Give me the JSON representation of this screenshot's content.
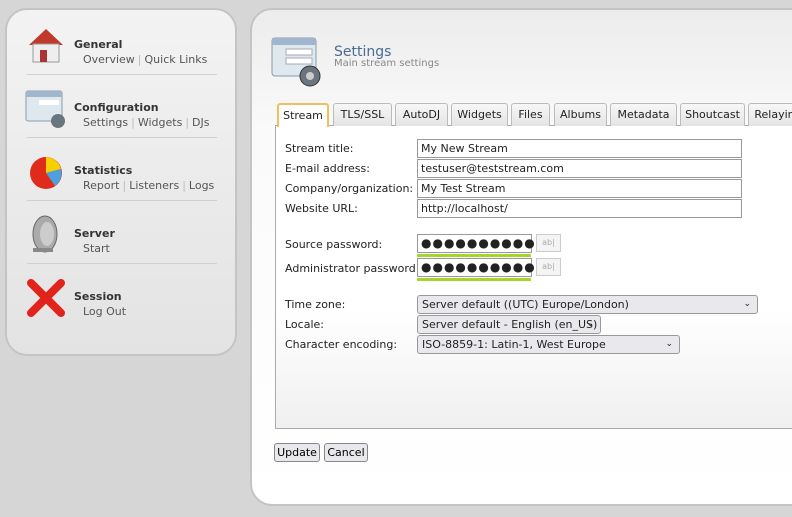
{
  "sidebar": {
    "sections": [
      {
        "title": "General",
        "icon": "house-icon",
        "links": [
          "Overview",
          "Quick Links"
        ]
      },
      {
        "title": "Configuration",
        "icon": "config-form-icon",
        "links": [
          "Settings",
          "Widgets",
          "DJs"
        ]
      },
      {
        "title": "Statistics",
        "icon": "pie-chart-icon",
        "links": [
          "Report",
          "Listeners",
          "Logs"
        ]
      },
      {
        "title": "Server",
        "icon": "satellite-dish-icon",
        "links": [
          "Start"
        ]
      },
      {
        "title": "Session",
        "icon": "red-x-icon",
        "links": [
          "Log Out"
        ]
      }
    ]
  },
  "header": {
    "title": "Settings",
    "subtitle": "Main stream settings"
  },
  "tabs": [
    "Stream",
    "TLS/SSL",
    "AutoDJ",
    "Widgets",
    "Files",
    "Albums",
    "Metadata",
    "Shoutcast",
    "Relaying"
  ],
  "active_tab": "Stream",
  "form": {
    "stream_title": {
      "label": "Stream title:",
      "value": "My New Stream"
    },
    "email": {
      "label": "E-mail address:",
      "value": "testuser@teststream.com"
    },
    "company": {
      "label": "Company/organization:",
      "value": "My Test Stream"
    },
    "website": {
      "label": "Website URL:",
      "value": "http://localhost/"
    },
    "source_password": {
      "label": "Source password:",
      "value": "●●●●●●●●●●●●",
      "strength_color": "#a6d52b"
    },
    "admin_password": {
      "label": "Administrator password:",
      "value": "●●●●●●●●●●●",
      "strength_color": "#a6d52b"
    },
    "show_password_label": "ab|",
    "timezone": {
      "label": "Time zone:",
      "value": "Server default ((UTC) Europe/London)"
    },
    "locale": {
      "label": "Locale:",
      "value": "Server default - English (en_US)"
    },
    "encoding": {
      "label": "Character encoding:",
      "value": "ISO-8859-1: Latin-1, West Europe"
    }
  },
  "buttons": {
    "update": "Update",
    "cancel": "Cancel"
  },
  "colors": {
    "accent_tab": "#f0c060",
    "title": "#4a6a95"
  }
}
